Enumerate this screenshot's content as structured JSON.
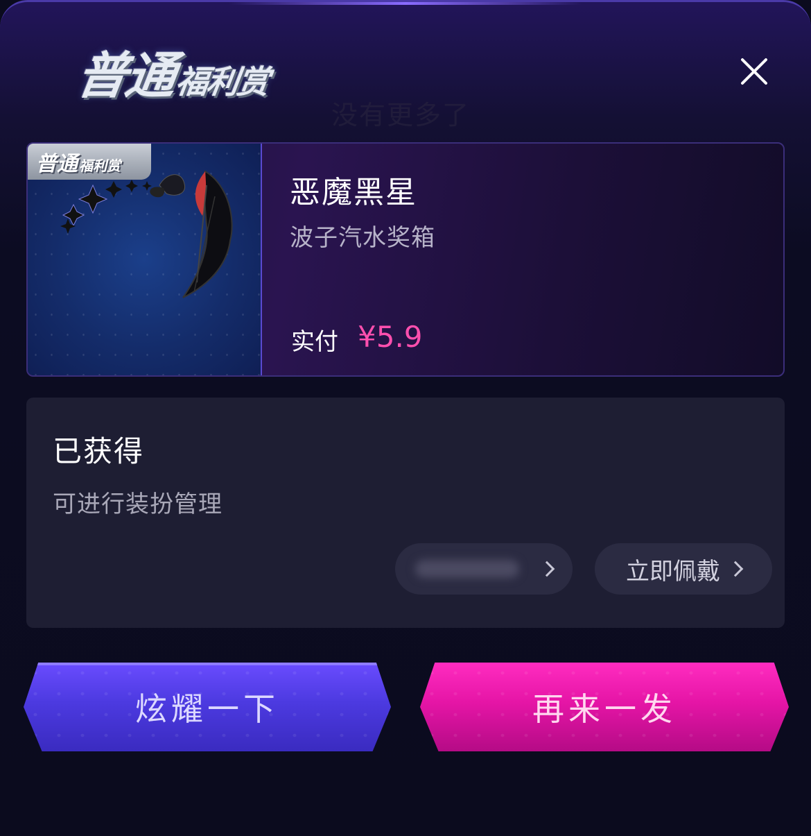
{
  "header": {
    "logo_main": "普通",
    "logo_sub": "福利赏",
    "ghost_text": "没有更多了",
    "close_icon": "close-icon"
  },
  "prize": {
    "badge_main": "普通",
    "badge_sub": "福利赏",
    "name": "恶魔黑星",
    "source": "波子汽水奖箱",
    "paid_label": "实付",
    "paid_price": "¥5.9",
    "price_color": "#ff4fae"
  },
  "status": {
    "title": "已获得",
    "description": "可进行装扮管理",
    "wear_button": "立即佩戴"
  },
  "actions": {
    "show_off": "炫耀一下",
    "draw_again": "再来一发"
  }
}
